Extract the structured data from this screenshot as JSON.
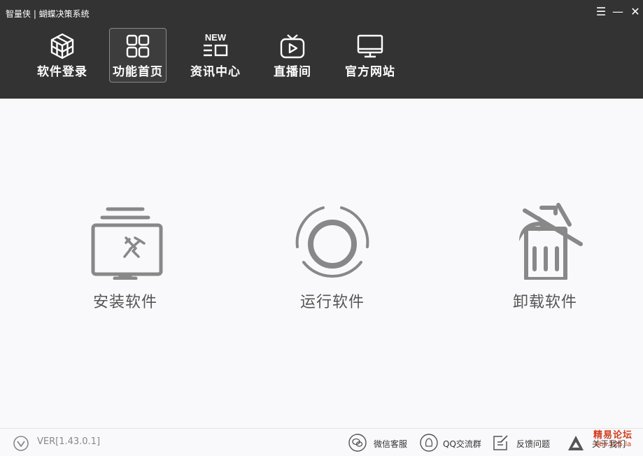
{
  "window": {
    "title": "智量侠 | 蝴蝶决策系统"
  },
  "controls": {
    "menu": "☰",
    "minimize": "—",
    "close": "✕"
  },
  "nav": {
    "items": [
      {
        "label": "软件登录",
        "icon": "cube-icon",
        "active": false
      },
      {
        "label": "功能首页",
        "icon": "grid-icon",
        "active": true
      },
      {
        "label": "资讯中心",
        "icon": "news-icon",
        "active": false,
        "badge": "NEW"
      },
      {
        "label": "直播间",
        "icon": "tv-icon",
        "active": false
      },
      {
        "label": "官方网站",
        "icon": "monitor-icon",
        "active": false
      }
    ]
  },
  "main": {
    "actions": [
      {
        "label": "安装软件",
        "icon": "install-monitor-icon"
      },
      {
        "label": "运行软件",
        "icon": "run-circle-icon"
      },
      {
        "label": "卸载软件",
        "icon": "trash-icon"
      }
    ]
  },
  "footer": {
    "version": "VER[1.43.0.1]",
    "wechat": "微信客服",
    "qq": "QQ交流群",
    "feedback": "反馈问题",
    "about": "关于我们"
  },
  "watermark": {
    "line1": "精易论坛",
    "line2": "bbs.125.la"
  },
  "colors": {
    "topbar": "#333333",
    "content_bg": "#f9f9fb",
    "icon_gray": "#888888",
    "label_gray": "#555555",
    "watermark": "#d33c1c"
  }
}
